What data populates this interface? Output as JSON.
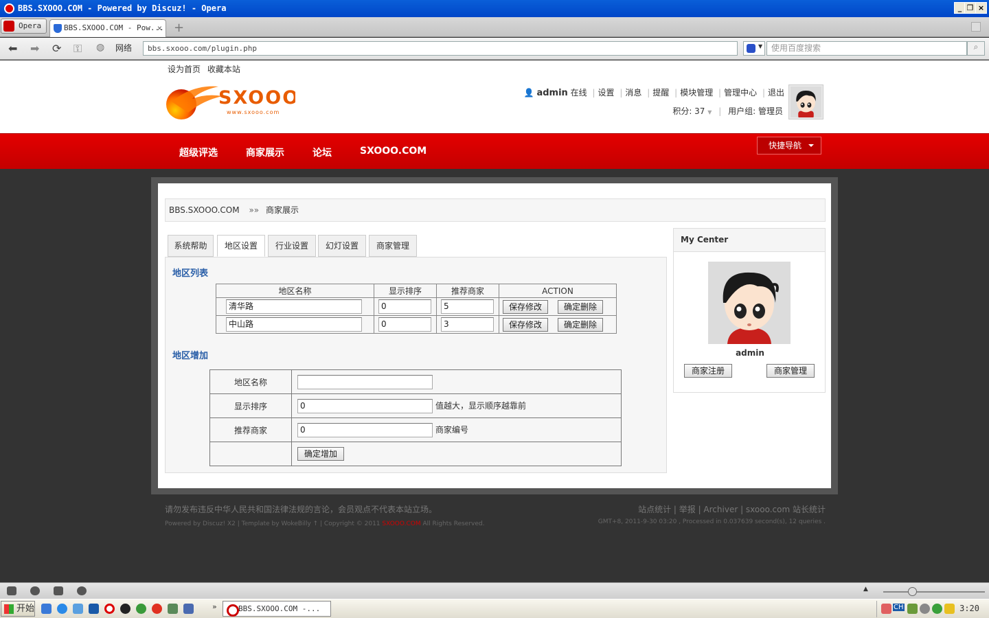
{
  "browser": {
    "window_title": "BBS.SXOOO.COM - Powered by Discuz! - Opera",
    "opera_button": "Opera",
    "tab_title": "BBS.SXOOO.COM - Pow...",
    "tab_close": "×",
    "new_tab": "+",
    "network_label": "网络",
    "url": "bbs.sxooo.com/plugin.php",
    "search_placeholder": "使用百度搜索",
    "win_buttons": [
      "_",
      "❐",
      "×"
    ]
  },
  "site": {
    "top_links": [
      "设为首页",
      "收藏本站"
    ],
    "logo_text": "SXOOO",
    "logo_sub": "www.sxooo.com",
    "user": {
      "name": "admin",
      "status": "在线",
      "links": [
        "设置",
        "消息",
        "提醒",
        "模块管理",
        "管理中心",
        "退出"
      ],
      "points": "积分: 37",
      "group": "用户组: 管理员"
    },
    "nav": [
      "超级评选",
      "商家展示",
      "论坛",
      "SXOOO.COM"
    ],
    "quick_nav": "快捷导航"
  },
  "breadcrumb": {
    "home": "BBS.SXOOO.COM",
    "sep": "»»",
    "current": "商家展示"
  },
  "tabs": [
    {
      "label": "系统帮助",
      "active": false
    },
    {
      "label": "地区设置",
      "active": true
    },
    {
      "label": "行业设置",
      "active": false
    },
    {
      "label": "幻灯设置",
      "active": false
    },
    {
      "label": "商家管理",
      "active": false
    }
  ],
  "region_list": {
    "title": "地区列表",
    "headers": [
      "地区名称",
      "显示排序",
      "推荐商家",
      "ACTION"
    ],
    "rows": [
      {
        "name": "清华路",
        "order": "0",
        "recommend": "5"
      },
      {
        "name": "中山路",
        "order": "0",
        "recommend": "3"
      }
    ],
    "save_label": "保存修改",
    "delete_label": "确定删除"
  },
  "region_add": {
    "title": "地区增加",
    "fields": [
      {
        "label": "地区名称",
        "value": "",
        "hint": ""
      },
      {
        "label": "显示排序",
        "value": "0",
        "hint": "值越大，显示顺序越靠前"
      },
      {
        "label": "推荐商家",
        "value": "0",
        "hint": "商家编号"
      }
    ],
    "submit_label": "确定增加"
  },
  "my_center": {
    "title": "My Center",
    "name": "admin",
    "register_label": "商家注册",
    "manage_label": "商家管理"
  },
  "footer": {
    "notice": "请勿发布违反中华人民共和国法律法规的言论，会员观点不代表本站立场。",
    "links": "站点统计 | 举报 | Archiver | sxooo.com 站长统计",
    "powered": "Powered by Discuz! X2 | Template by WokeBilly ↑ | Copyright © 2011",
    "brand": "SXOOO.COM",
    "rights": "All Rights Reserved.",
    "gmt": "GMT+8, 2011-9-30 03:20 , Processed in 0.037639 second(s), 12 queries ."
  },
  "taskbar": {
    "start": "开始",
    "task": "BBS.SXOOO.COM -...",
    "time": "3:20",
    "ime": "CH"
  },
  "colors": {
    "brand_red": "#d10000",
    "link_blue": "#2a5fa8"
  }
}
